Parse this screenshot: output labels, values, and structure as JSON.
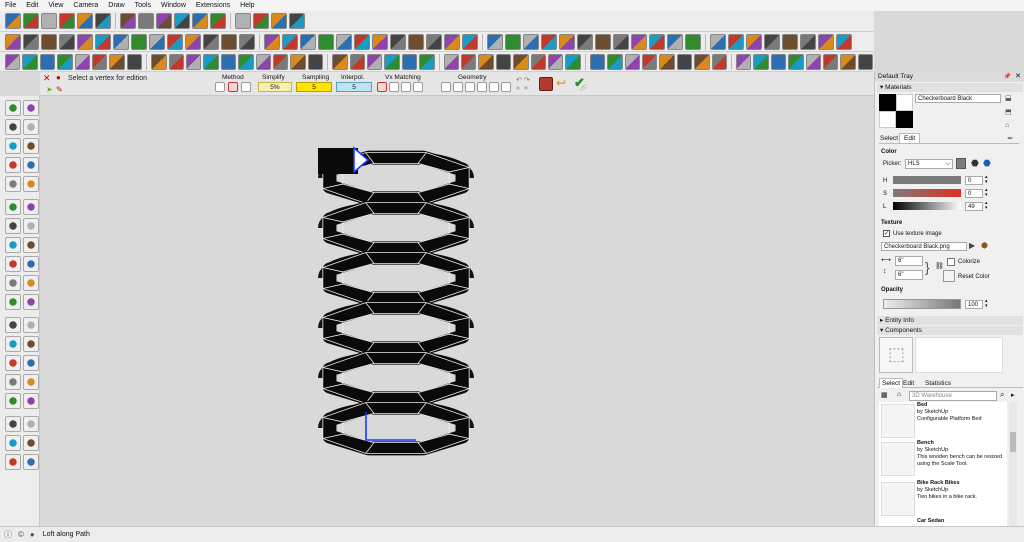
{
  "menubar": {
    "items": [
      "File",
      "Edit",
      "View",
      "Camera",
      "Draw",
      "Tools",
      "Window",
      "Extensions",
      "Help"
    ]
  },
  "loft_toolbar": {
    "hint": "Select a vertex for edition",
    "method_label": "Method",
    "simplify_label": "Simplify",
    "simplify_value": "5%",
    "sampling_label": "Sampling",
    "sampling_value": "5",
    "interpol_label": "Interpol.",
    "interpol_value": "5",
    "vx_matching_label": "Vx Matching",
    "geometry_label": "Geometry"
  },
  "tray": {
    "title": "Default Tray",
    "materials": {
      "header": "Materials",
      "material_name": "Checkerboard Black",
      "tab_select": "Select",
      "tab_edit": "Edit",
      "color_label": "Color",
      "picker_label": "Picker:",
      "picker_value": "HLS",
      "h_label": "H",
      "h_value": "0",
      "s_label": "S",
      "s_value": "0",
      "l_label": "L",
      "l_value": "49",
      "texture_label": "Texture",
      "use_texture": "Use texture image",
      "texture_file": "Checkerboard Black.png",
      "width_value": "6\"",
      "height_value": "6\"",
      "colorize_label": "Colorize",
      "reset_color_label": "Reset Color",
      "opacity_label": "Opacity",
      "opacity_value": "100",
      "accent": "#e03020"
    },
    "entity_info_header": "Entity Info",
    "components": {
      "header": "Components",
      "tab_select": "Select",
      "tab_edit": "Edit",
      "tab_statistics": "Statistics",
      "search_placeholder": "3D Warehouse",
      "items": [
        {
          "name": "Bed",
          "by": "by SketchUp",
          "desc": "Configurable Platform Bed"
        },
        {
          "name": "Bench",
          "by": "by SketchUp",
          "desc": "This wooden bench can be resized using the Scale Tool."
        },
        {
          "name": "Bike Rack Bikes",
          "by": "by SketchUp",
          "desc": "Two bikes in a bike rack."
        },
        {
          "name": "Car Sedan",
          "by": "by SketchUp",
          "desc": ""
        }
      ]
    }
  },
  "status": {
    "text": "Loft along Path"
  },
  "colors": {
    "brand_red": "#c0392b",
    "viewport": "#d9d9d9",
    "accent_green": "#2e8b2e",
    "model_black": "#0a0a0a"
  }
}
